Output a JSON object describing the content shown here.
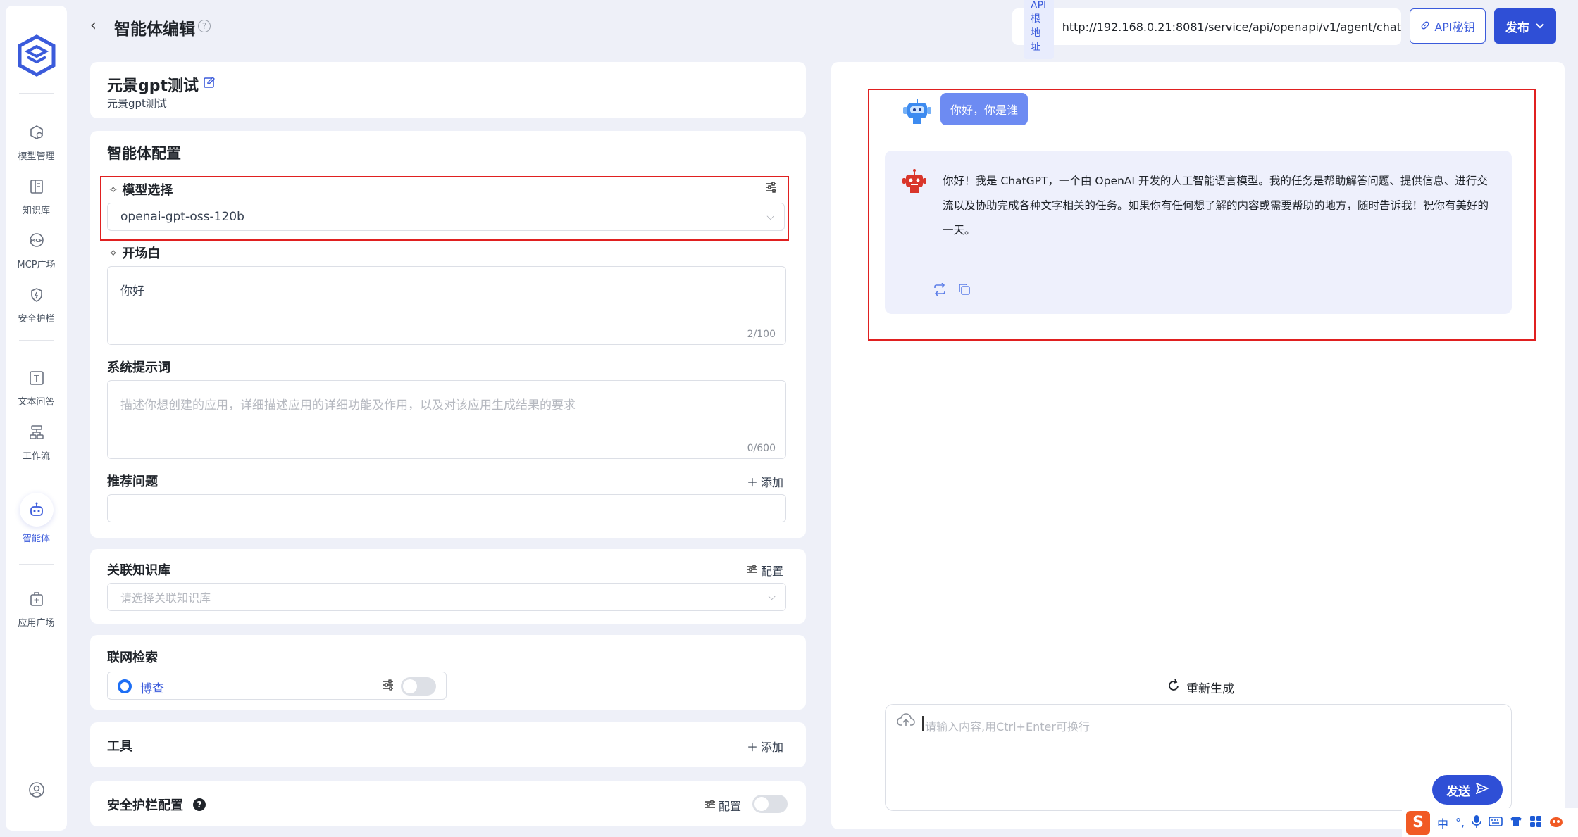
{
  "sidebar": {
    "items": [
      {
        "label": "模型管理",
        "icon": "model-icon"
      },
      {
        "label": "知识库",
        "icon": "knowledge-icon"
      },
      {
        "label": "MCP广场",
        "icon": "mcp-icon"
      },
      {
        "label": "安全护栏",
        "icon": "shield-icon"
      },
      {
        "label": "文本问答",
        "icon": "text-qa-icon"
      },
      {
        "label": "工作流",
        "icon": "workflow-icon"
      },
      {
        "label": "智能体",
        "icon": "agent-icon"
      },
      {
        "label": "应用广场",
        "icon": "app-plaza-icon"
      }
    ]
  },
  "header": {
    "back": "‹",
    "title": "智能体编辑",
    "help": "?",
    "api_tag": "API根地址",
    "api_url": "http://192.168.0.21:8081/service/api/openapi/v1/agent/chat",
    "api_key_label": "API秘钥",
    "publish_label": "发布"
  },
  "agent": {
    "name": "元景gpt测试",
    "desc": "元景gpt测试"
  },
  "config": {
    "title": "智能体配置",
    "model_label": "模型选择",
    "model_value": "openai-gpt-oss-120b",
    "opening_label": "开场白",
    "opening_value": "你好",
    "opening_count": "2/100",
    "system_label": "系统提示词",
    "system_placeholder": "描述你想创建的应用，详细描述应用的详细功能及作用，以及对该应用生成结果的要求",
    "system_count": "0/600",
    "recommend_label": "推荐问题",
    "add_label": "添加"
  },
  "kb": {
    "title": "关联知识库",
    "config_label": "配置",
    "placeholder": "请选择关联知识库"
  },
  "web": {
    "title": "联网检索",
    "item": "博查"
  },
  "tools": {
    "title": "工具",
    "add_label": "添加"
  },
  "guard": {
    "title": "安全护栏配置",
    "config_label": "配置"
  },
  "chat": {
    "user_message": "你好，你是谁",
    "bot_message": "你好！我是 ChatGPT，一个由 OpenAI 开发的人工智能语言模型。我的任务是帮助解答问题、提供信息、进行交流以及协助完成各种文字相关的任务。如果你有任何想了解的内容或需要帮助的地方，随时告诉我！祝你有美好的一天。",
    "regenerate_label": "重新生成",
    "input_placeholder": "请输入内容,用Ctrl+Enter可换行",
    "send_label": "发送"
  },
  "ime": {
    "logo": "S",
    "mode": "中",
    "punct": "°,"
  },
  "colors": {
    "accent": "#2f4fd6",
    "highlight_frame": "#e02020",
    "user_bubble": "#6d8bf2"
  }
}
